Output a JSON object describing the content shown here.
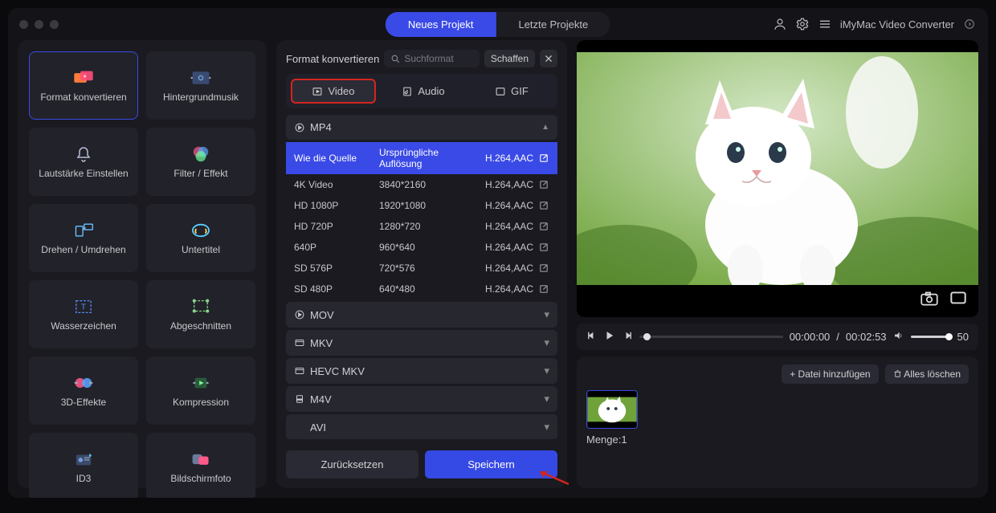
{
  "titlebar": {
    "tabs": {
      "new": "Neues Projekt",
      "recent": "Letzte Projekte"
    },
    "app_name": "iMyMac Video Converter"
  },
  "sidebar": {
    "items": [
      {
        "id": "format-convert",
        "label": "Format konvertieren",
        "active": true
      },
      {
        "id": "bg-music",
        "label": "Hintergrundmusik"
      },
      {
        "id": "volume",
        "label": "Lautstärke Einstellen"
      },
      {
        "id": "filter",
        "label": "Filter / Effekt"
      },
      {
        "id": "rotate",
        "label": "Drehen / Umdrehen"
      },
      {
        "id": "subtitle",
        "label": "Untertitel"
      },
      {
        "id": "watermark",
        "label": "Wasserzeichen"
      },
      {
        "id": "crop",
        "label": "Abgeschnitten"
      },
      {
        "id": "3d",
        "label": "3D-Effekte"
      },
      {
        "id": "compress",
        "label": "Kompression"
      },
      {
        "id": "id3",
        "label": "ID3"
      },
      {
        "id": "screenshot",
        "label": "Bildschirmfoto"
      }
    ]
  },
  "middle": {
    "title": "Format konvertieren",
    "search_placeholder": "Suchformat",
    "create_label": "Schaffen",
    "tabs": {
      "video": "Video",
      "audio": "Audio",
      "gif": "GIF"
    },
    "buttons": {
      "reset": "Zurücksetzen",
      "save": "Speichern"
    },
    "formats": [
      {
        "name": "MP4",
        "open": true,
        "presets": [
          {
            "name": "Wie die Quelle",
            "res": "Ursprüngliche Auflösung",
            "codec": "H.264,AAC",
            "active": true
          },
          {
            "name": "4K Video",
            "res": "3840*2160",
            "codec": "H.264,AAC"
          },
          {
            "name": "HD 1080P",
            "res": "1920*1080",
            "codec": "H.264,AAC"
          },
          {
            "name": "HD 720P",
            "res": "1280*720",
            "codec": "H.264,AAC"
          },
          {
            "name": "640P",
            "res": "960*640",
            "codec": "H.264,AAC"
          },
          {
            "name": "SD 576P",
            "res": "720*576",
            "codec": "H.264,AAC"
          },
          {
            "name": "SD 480P",
            "res": "640*480",
            "codec": "H.264,AAC"
          }
        ]
      },
      {
        "name": "MOV"
      },
      {
        "name": "MKV"
      },
      {
        "name": "HEVC MKV"
      },
      {
        "name": "M4V"
      },
      {
        "name": "AVI"
      }
    ]
  },
  "right": {
    "time_current": "00:00:00",
    "time_total": "00:02:53",
    "volume": "50",
    "add_file": "+ Datei hinzufügen",
    "clear_all": "Alles löschen",
    "count_label": "Menge:",
    "count_value": "1"
  }
}
